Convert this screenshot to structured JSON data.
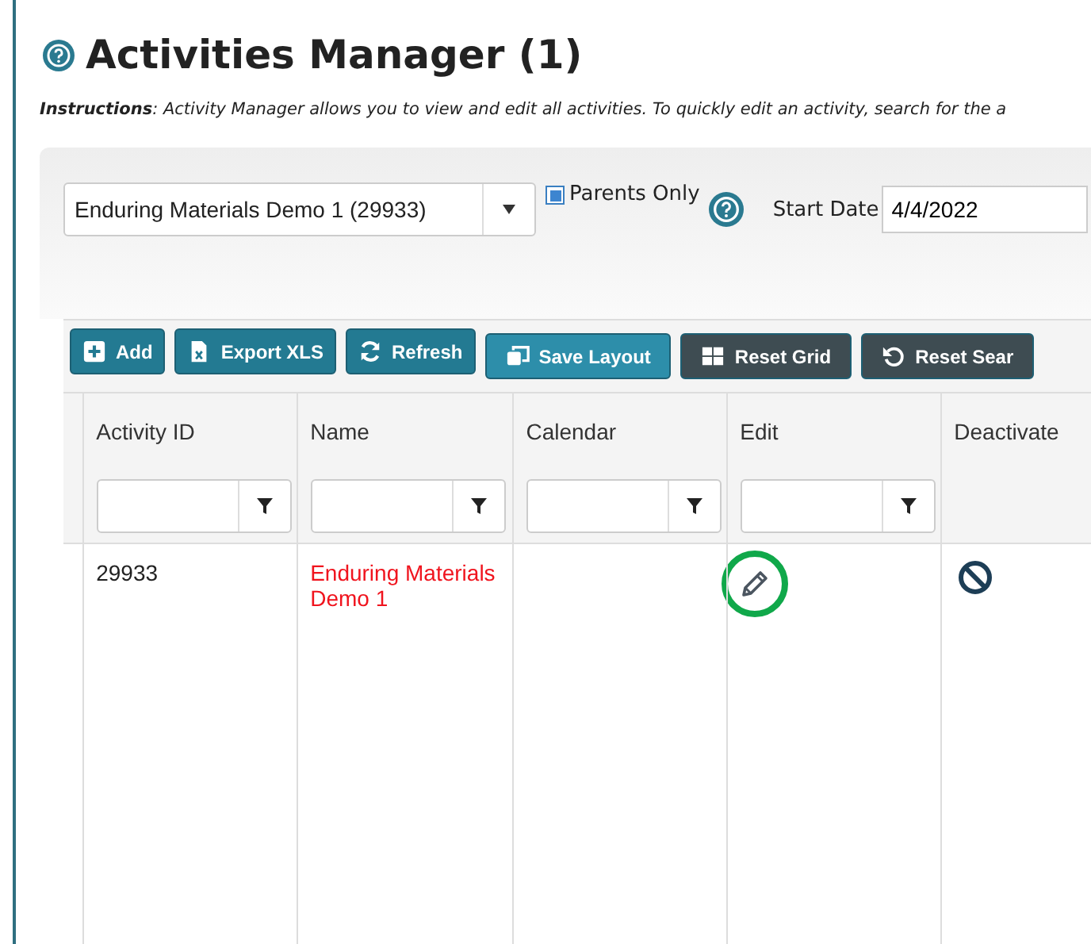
{
  "title": "Activities Manager (1)",
  "instructions": {
    "label": "Instructions",
    "text": ": Activity Manager allows you to view and edit all activities. To quickly edit an activity, search for the a"
  },
  "filters": {
    "activity_select": "Enduring Materials Demo 1 (29933)",
    "parents_only": {
      "label": "Parents Only",
      "checked": true
    },
    "start_date": {
      "label": "Start Date",
      "value": "4/4/2022"
    }
  },
  "toolbar": [
    {
      "label": "Add"
    },
    {
      "label": "Export XLS"
    },
    {
      "label": "Refresh"
    },
    {
      "label": "Save Layout"
    },
    {
      "label": "Reset Grid"
    },
    {
      "label": "Reset Sear"
    }
  ],
  "table": {
    "columns": [
      {
        "label": "Activity ID",
        "filter": true
      },
      {
        "label": "Name",
        "filter": true
      },
      {
        "label": "Calendar",
        "filter": true
      },
      {
        "label": "Edit",
        "filter": true
      },
      {
        "label": "Deactivate",
        "filter": false
      }
    ],
    "rows": [
      {
        "activity_id": "29933",
        "name": "Enduring Materials Demo 1",
        "calendar": "",
        "edit_highlighted": true
      }
    ]
  }
}
